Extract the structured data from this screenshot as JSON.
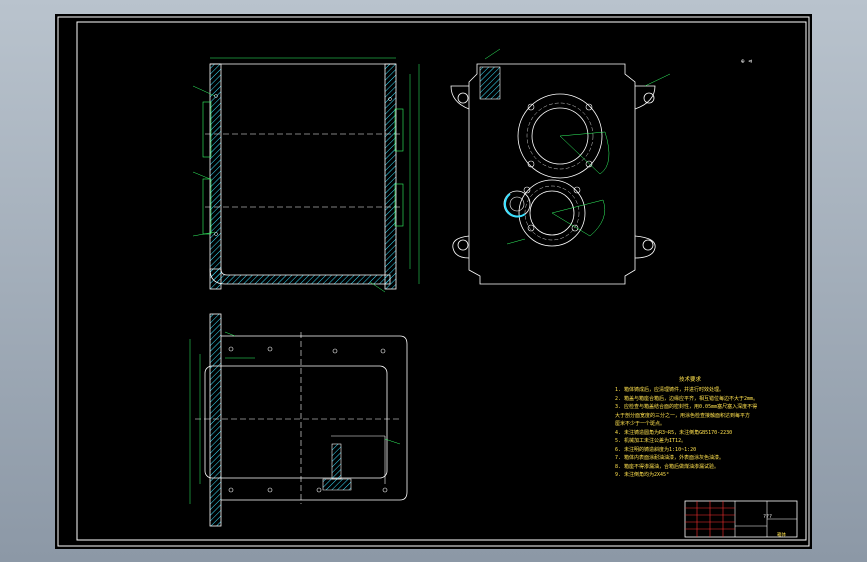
{
  "drawing": {
    "colors": {
      "background": "#000000",
      "outline": "#ffffff",
      "dimension": "#33ff66",
      "center_line": "#ffffff",
      "hatch": "#38e0ff",
      "text": "#ffe14d",
      "title_block_red": "#ff3030"
    },
    "scale_mark": "⊕ ⊲",
    "technical_requirements": {
      "title": "技术要求",
      "lines": [
        "1. 箱体铸成后，应清理铸件，并进行时效处理。",
        "2. 箱盖与箱座合箱后，边缘应平齐，相互错位每边不大于2mm。",
        "3. 应检查与箱盖结合面的密封性，用0.05mm塞尺塞入深度不得",
        "   大于剖分面宽度的三分之一，用涂色检查接触面积达到每平方",
        "   厘米不少于一个斑点。",
        "4. 未注铸造圆角为R3~R5，未注倒角GB5170-2230",
        "5. 机械加工未注公差为IT12。",
        "6. 未注明的铸造斜度为1:10~1:20",
        "7. 箱体内表面涂耐油油漆，外表面涂灰色油漆。",
        "8. 箱座不得渗漏油，合箱后做煤油渗漏试验。",
        "9. 未注倒角均为2X45°"
      ]
    },
    "title_block": {
      "drawing_code": "???",
      "part_name": "箱体"
    }
  }
}
